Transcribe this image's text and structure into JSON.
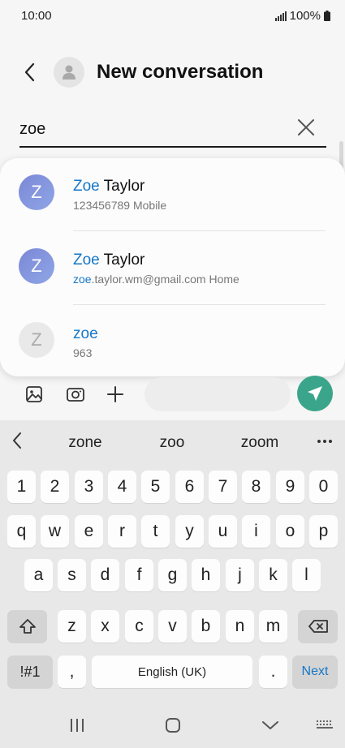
{
  "status_bar": {
    "time": "10:00",
    "battery": "100%"
  },
  "header": {
    "title": "New conversation"
  },
  "search": {
    "value": "zoe"
  },
  "contacts": [
    {
      "initial": "Z",
      "name_match": "Zoe",
      "name_rest": " Taylor",
      "detail_match": "",
      "detail_rest": "123456789  Mobile",
      "avatar": "blue"
    },
    {
      "initial": "Z",
      "name_match": "Zoe",
      "name_rest": " Taylor",
      "detail_match": "zoe",
      "detail_rest": ".taylor.wm@gmail.com  Home",
      "avatar": "blue"
    },
    {
      "initial": "Z",
      "name_match": "zoe",
      "name_rest": "",
      "detail_match": "",
      "detail_rest": "963",
      "avatar": "grey"
    }
  ],
  "keyboard": {
    "suggestions": [
      "zone",
      "zoo",
      "zoom"
    ],
    "number_row": [
      "1",
      "2",
      "3",
      "4",
      "5",
      "6",
      "7",
      "8",
      "9",
      "0"
    ],
    "row1": [
      "q",
      "w",
      "e",
      "r",
      "t",
      "y",
      "u",
      "i",
      "o",
      "p"
    ],
    "row2": [
      "a",
      "s",
      "d",
      "f",
      "g",
      "h",
      "j",
      "k",
      "l"
    ],
    "row3": [
      "z",
      "x",
      "c",
      "v",
      "b",
      "n",
      "m"
    ],
    "symbols_label": "!#1",
    "comma": ",",
    "space_label": "English (UK)",
    "period": ".",
    "next_label": "Next"
  },
  "colors": {
    "accent": "#1677c8",
    "send": "#3aa58a",
    "avatar": "#7b87d6"
  }
}
